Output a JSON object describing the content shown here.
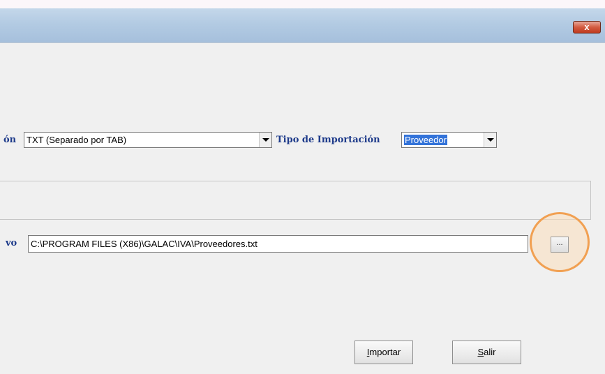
{
  "window": {
    "close_label": "x"
  },
  "form": {
    "format_label_fragment": "ón",
    "format_value": "TXT (Separado por TAB)",
    "import_type_label": "Tipo de Importación",
    "import_type_value": "Proveedor",
    "file_label_fragment": "vo",
    "file_path_value": "C:\\PROGRAM FILES (X86)\\GALAC\\IVA\\Proveedores.txt",
    "browse_label": "...",
    "highlight_color": "#f1a052"
  },
  "buttons": {
    "import_mnemonic": "I",
    "import_rest": "mportar",
    "exit_mnemonic": "S",
    "exit_rest": "alir"
  }
}
